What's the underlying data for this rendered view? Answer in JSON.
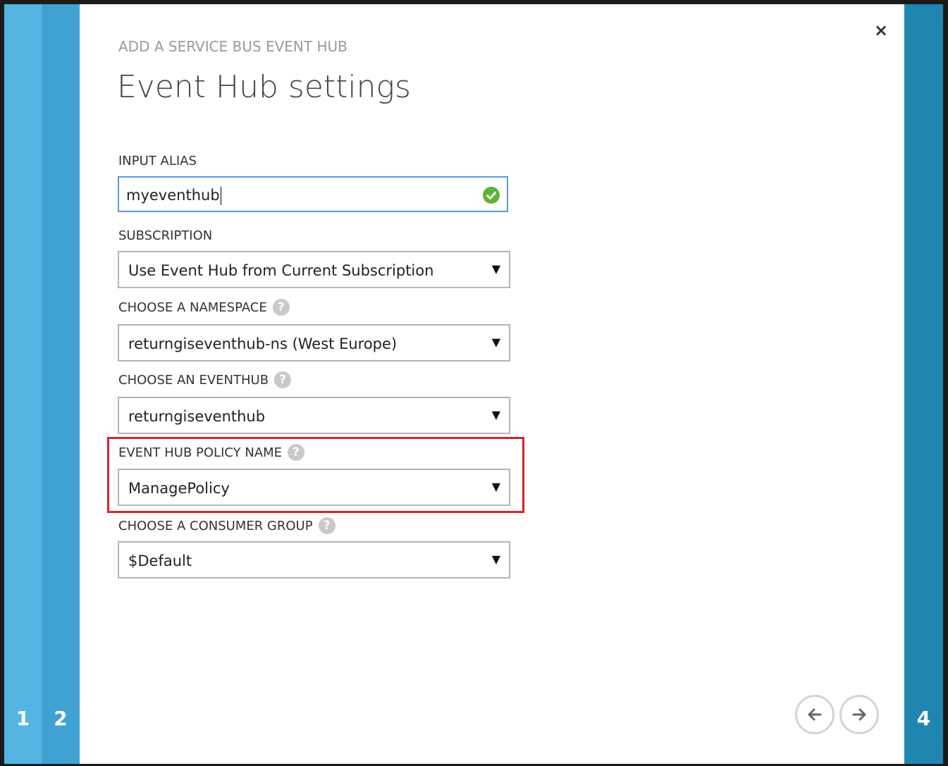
{
  "wizard": {
    "steps_left": [
      "1",
      "2"
    ],
    "step_right": "4"
  },
  "dialog": {
    "subtitle": "ADD A SERVICE BUS EVENT HUB",
    "title": "Event Hub settings",
    "close_label": "×"
  },
  "fields": {
    "input_alias": {
      "label": "INPUT ALIAS",
      "value": "myeventhub"
    },
    "subscription": {
      "label": "SUBSCRIPTION",
      "value": "Use Event Hub from Current Subscription"
    },
    "namespace": {
      "label": "CHOOSE A NAMESPACE",
      "value": "returngiseventhub-ns (West Europe)"
    },
    "eventhub": {
      "label": "CHOOSE AN EVENTHUB",
      "value": "returngiseventhub"
    },
    "policy": {
      "label": "EVENT HUB POLICY NAME",
      "value": "ManagePolicy"
    },
    "consumer_group": {
      "label": "CHOOSE A CONSUMER GROUP",
      "value": "$Default"
    }
  },
  "icons": {
    "help": "help-icon",
    "valid": "check-circle-icon",
    "dropdown": "triangle-down-icon",
    "back": "arrow-left-icon",
    "next": "arrow-right-icon"
  },
  "colors": {
    "step1": "#54b5e2",
    "step2": "#3fa2d3",
    "step4": "#1f86b2",
    "input_border_focus": "#5b9bd5",
    "valid_green": "#5cb531",
    "highlight_red": "#d6232e"
  }
}
